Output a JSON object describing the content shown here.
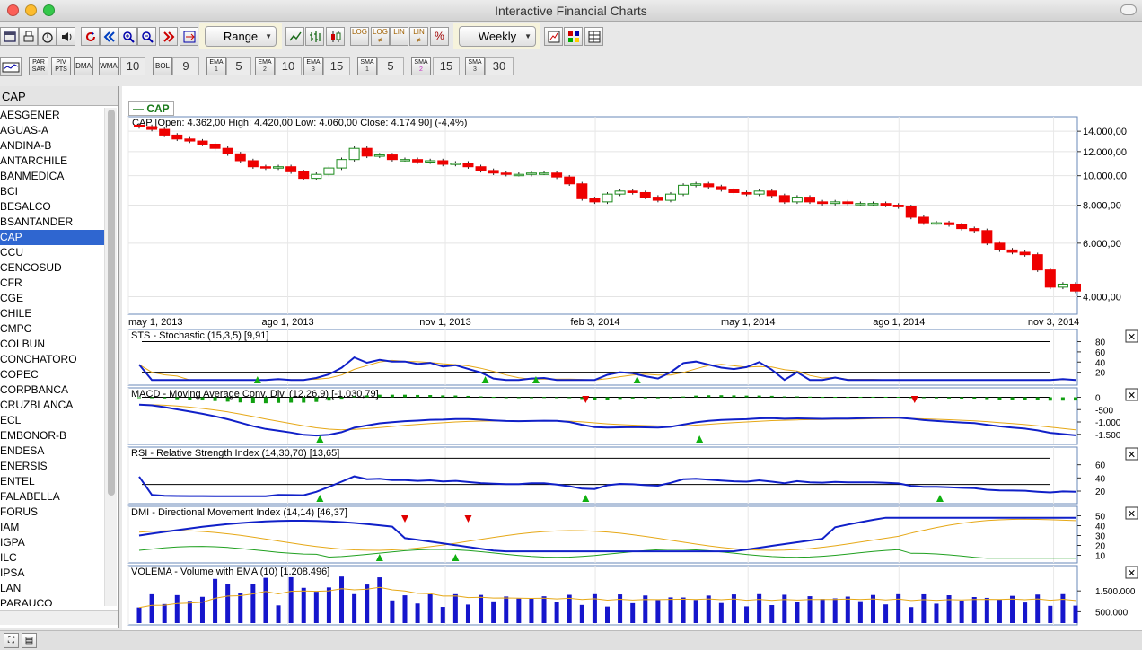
{
  "window": {
    "title": "Interactive Financial Charts"
  },
  "toolbar": {
    "range_label": "Range",
    "period_label": "Weekly",
    "scale_buttons": [
      "LOG",
      "LOG",
      "LIN",
      "LIN",
      "%"
    ]
  },
  "indicators_bar": {
    "par_sar": "PAR SAR",
    "piv_pts": "PIV PTS",
    "dma": "DMA",
    "wma": "WMA",
    "wma_value": "10",
    "bol": "BOL",
    "bol_value": "9",
    "ema1": "EMA",
    "ema1_sub": "1",
    "ema1_value": "5",
    "ema2": "EMA",
    "ema2_sub": "2",
    "ema2_value": "10",
    "ema3": "EMA",
    "ema3_sub": "3",
    "ema3_value": "15",
    "sma1": "SMA",
    "sma1_sub": "1",
    "sma1_value": "5",
    "sma2": "SMA",
    "sma2_sub": "2",
    "sma2_value": "15",
    "sma3": "SMA",
    "sma3_sub": "3",
    "sma3_value": "30"
  },
  "sidebar": {
    "header": "CAP",
    "tickers": [
      "AESGENER",
      "AGUAS-A",
      "ANDINA-B",
      "ANTARCHILE",
      "BANMEDICA",
      "BCI",
      "BESALCO",
      "BSANTANDER",
      "CAP",
      "CCU",
      "CENCOSUD",
      "CFR",
      "CGE",
      "CHILE",
      "CMPC",
      "COLBUN",
      "CONCHATORO",
      "COPEC",
      "CORPBANCA",
      "CRUZBLANCA",
      "ECL",
      "EMBONOR-B",
      "ENDESA",
      "ENERSIS",
      "ENTEL",
      "FALABELLA",
      "FORUS",
      "IAM",
      "IGPA",
      "ILC",
      "IPSA",
      "LAN",
      "PARAUCO"
    ],
    "selected": "CAP"
  },
  "chart": {
    "legend": "CAP",
    "price_label": "CAP [Open: 4.362,00  High: 4.420,00  Low: 4.060,00  Close: 4.174,90]  (-4,4%)",
    "price_ticks": [
      "14.000,00",
      "12.000,00",
      "10.000,00",
      "8.000,00",
      "6.000,00",
      "4.000,00"
    ],
    "date_ticks": [
      "may 1, 2013",
      "ago 1, 2013",
      "nov 1, 2013",
      "feb 3, 2014",
      "may 1, 2014",
      "ago 1, 2014",
      "nov 3, 2014"
    ],
    "sts_label": "STS - Stochastic (15,3,5) [9,91]",
    "sts_ticks": [
      "80",
      "60",
      "40",
      "20"
    ],
    "macd_label": "MACD - Moving Average Conv. Div. (12,26,9) [-1.030,79]",
    "macd_ticks": [
      "0",
      "-500",
      "-1.000",
      "-1.500"
    ],
    "rsi_label": "RSI - Relative Strength Index (14,30,70) [13,65]",
    "rsi_ticks": [
      "60",
      "40",
      "20"
    ],
    "dmi_label": "DMI - Directional Movement Index (14,14) [46,37]",
    "dmi_ticks": [
      "50",
      "40",
      "30",
      "20",
      "10"
    ],
    "vol_label": "VOLEMA - Volume with EMA (10) [1.208.496]",
    "vol_ticks": [
      "1.500.000",
      "500.000"
    ],
    "close_icon": "✕"
  },
  "colors": {
    "up": "#ffffff",
    "down": "#ee0000",
    "candle_up_border": "#1a8a1a",
    "line_blue": "#1020c8",
    "line_orange": "#e6a817",
    "line_green": "#20a020",
    "volume": "#1515cc",
    "selected": "#2f66d0"
  },
  "chart_data": {
    "type": "candlestick",
    "title": "CAP [Open: 4.362,00  High: 4.420,00  Low: 4.060,00  Close: 4.174,90]  (-4,4%)",
    "x_range": [
      "may 1, 2013",
      "nov 2014"
    ],
    "ylim": [
      3600,
      15000
    ],
    "close_series": [
      14500,
      14200,
      13600,
      13200,
      13000,
      12700,
      12300,
      11800,
      11200,
      10700,
      10600,
      10700,
      10300,
      9800,
      10100,
      10600,
      11300,
      12300,
      11600,
      11700,
      11300,
      11300,
      11100,
      11200,
      10900,
      11000,
      10700,
      10400,
      10200,
      10100,
      10100,
      10200,
      10200,
      9900,
      9400,
      8400,
      8200,
      8700,
      8900,
      8800,
      8500,
      8300,
      8700,
      9300,
      9400,
      9200,
      9000,
      8800,
      8700,
      8900,
      8600,
      8200,
      8500,
      8200,
      8100,
      8200,
      8100,
      8100,
      8100,
      8000,
      7900,
      7300,
      7000,
      7000,
      6900,
      6700,
      6600,
      6000,
      5700,
      5600,
      5500,
      4900,
      4300,
      4400,
      4175
    ]
  }
}
